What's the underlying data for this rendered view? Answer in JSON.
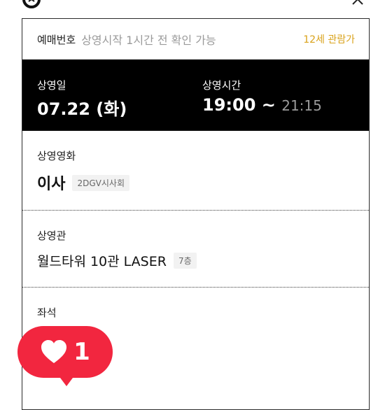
{
  "header": {
    "logo_icon": "brand-logo-icon",
    "close_icon": "close-icon"
  },
  "ticket": {
    "booking_label": "예매번호",
    "booking_note": "상영시작 1시간 전 확인 가능",
    "age_rating": "12세 관람가",
    "date_label": "상영일",
    "date_value": "07.22 (화)",
    "time_label": "상영시간",
    "time_start": "19:00 ~ ",
    "time_end": "21:15",
    "movie_label": "상영영화",
    "movie_title": "이사",
    "movie_format": "2DGV시사회",
    "hall_label": "상영관",
    "hall_name": "월드타워 10관 LASER",
    "hall_floor": "7층",
    "seat_label": "좌석"
  },
  "like": {
    "count": "1",
    "icon": "heart-icon",
    "color": "#f2263f"
  },
  "colors": {
    "accent_age": "#d9a21a",
    "dark_band": "#000000"
  }
}
